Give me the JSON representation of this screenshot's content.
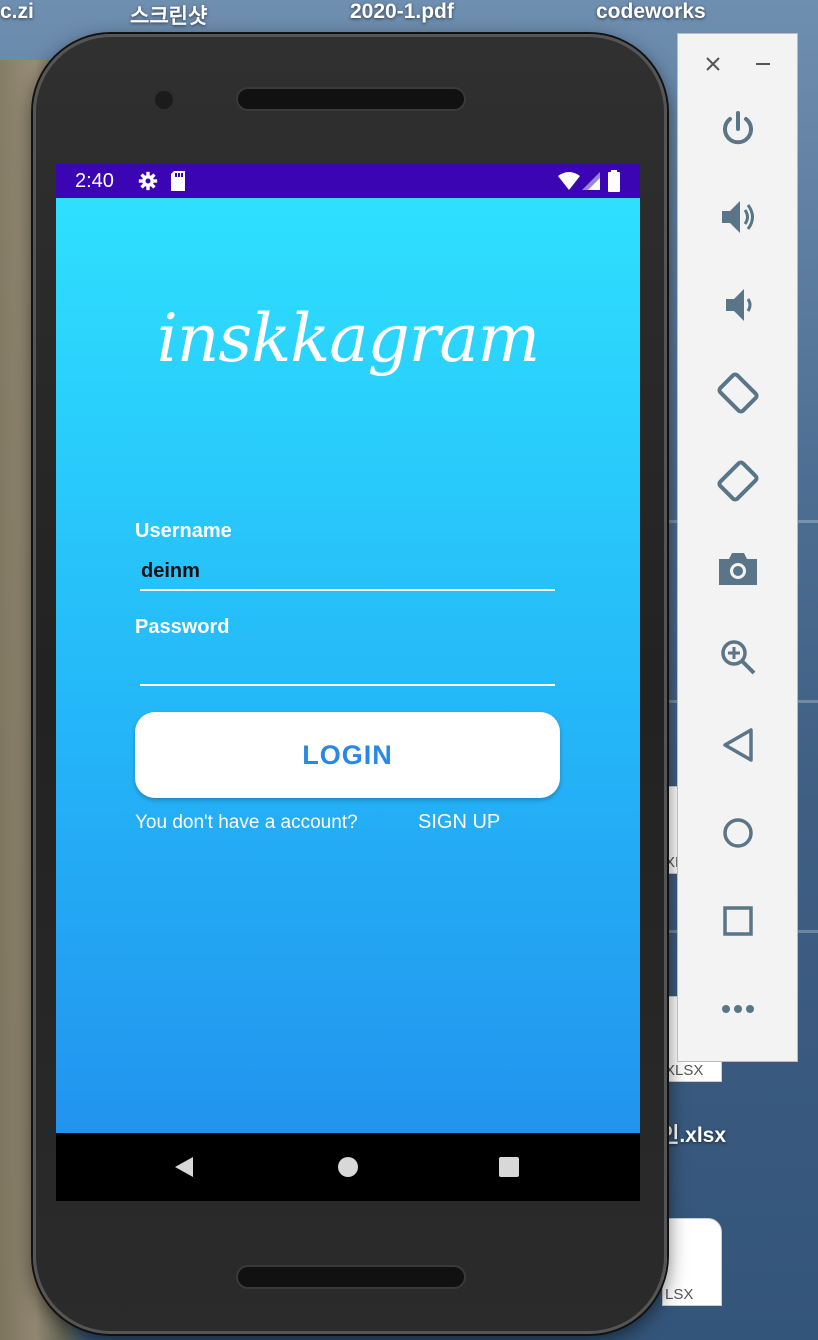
{
  "desktop": {
    "labels": [
      "c.zi",
      "스크린샷",
      "2020-1.pdf",
      "codeworks",
      "인.xlsx"
    ],
    "thumbs": [
      "XLSX",
      "XLSX",
      "LSX"
    ]
  },
  "status_bar": {
    "time": "2:40",
    "icons": [
      "settings-gear-icon",
      "sd-card-icon",
      "wifi-icon",
      "signal-icon",
      "battery-icon"
    ],
    "color": "#3b05b3"
  },
  "app": {
    "logo": "inskkagram",
    "username_label": "Username",
    "username_value": "deinm",
    "password_label": "Password",
    "password_value": "",
    "login_button": "LOGIN",
    "no_account_text": "You don't have a account?",
    "signup_link": "SIGN UP",
    "gradient_top": "#2ee0fe",
    "gradient_bottom": "#2294ee",
    "login_text_color": "#2888e5"
  },
  "nav_bar": {
    "buttons": [
      "back-icon",
      "home-icon",
      "recents-icon"
    ]
  },
  "emulator_panel": {
    "window_controls": [
      "close-icon",
      "minimize-icon"
    ],
    "buttons": [
      "power-icon",
      "volume-up-icon",
      "volume-down-icon",
      "rotate-left-icon",
      "rotate-right-icon",
      "camera-icon",
      "zoom-icon",
      "back-icon",
      "home-icon",
      "overview-icon",
      "more-icon"
    ]
  }
}
